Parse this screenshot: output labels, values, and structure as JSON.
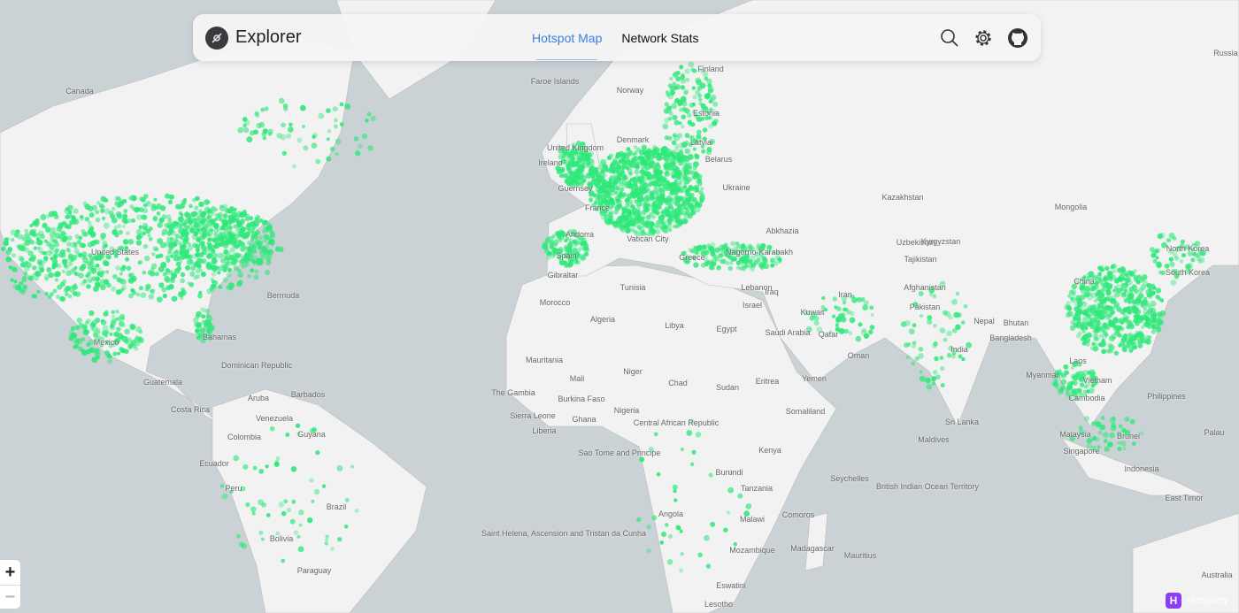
{
  "header": {
    "brand": "Explorer",
    "tabs": [
      {
        "label": "Hotspot Map",
        "active": true
      },
      {
        "label": "Network Stats",
        "active": false
      }
    ]
  },
  "colors": {
    "accent": "#3b7ee0",
    "hotspot": "#2fe87a",
    "ocean": "#cbd2d5",
    "land": "#f2f2f2",
    "brand_badge": "#8a3ff0"
  },
  "map": {
    "labels": [
      "Canada",
      "United States",
      "Mexico",
      "Bermuda",
      "Bahamas",
      "Dominican Republic",
      "Guatemala",
      "Costa Rica",
      "Aruba",
      "Barbados",
      "Venezuela",
      "Colombia",
      "Guyana",
      "Ecuador",
      "Peru",
      "Brazil",
      "Bolivia",
      "Paraguay",
      "Faroe Islands",
      "Norway",
      "Finland",
      "Estonia",
      "Latvia",
      "Belarus",
      "Ukraine",
      "United Kingdom",
      "Ireland",
      "Denmark",
      "Guernsey",
      "France",
      "Andorra",
      "Spain",
      "Gibraltar",
      "Vatican City",
      "Greece",
      "Morocco",
      "Tunisia",
      "Algeria",
      "Libya",
      "Egypt",
      "Mauritania",
      "Mali",
      "Niger",
      "Chad",
      "Sudan",
      "Eritrea",
      "Yemen",
      "Somaliland",
      "The Gambia",
      "Sierra Leone",
      "Liberia",
      "Burkina Faso",
      "Ghana",
      "Nigeria",
      "Central African Republic",
      "Sao Tome and Principe",
      "Kenya",
      "Burundi",
      "Tanzania",
      "Angola",
      "Malawi",
      "Comoros",
      "Mozambique",
      "Madagascar",
      "Mauritius",
      "Seychelles",
      "Saint Helena, Ascension and Tristan da Cunha",
      "Eswatini",
      "Lesotho",
      "Abkhazia",
      "Nagorno-Karabakh",
      "Lebanon",
      "Israel",
      "Iraq",
      "Iran",
      "Kuwait",
      "Saudi Arabia",
      "Qatar",
      "Oman",
      "Kazakhstan",
      "Uzbekistan",
      "Kyrgyzstan",
      "Tajikistan",
      "Afghanistan",
      "Pakistan",
      "Nepal",
      "Bhutan",
      "Bangladesh",
      "India",
      "Sri Lanka",
      "Maldives",
      "British Indian Ocean Territory",
      "Mongolia",
      "China",
      "North Korea",
      "South Korea",
      "Myanmar",
      "Laos",
      "Vietnam",
      "Cambodia",
      "Philippines",
      "Malaysia",
      "Brunei",
      "Singapore",
      "Indonesia",
      "East Timor",
      "Palau",
      "Russia",
      "Australia"
    ]
  },
  "controls": {
    "zoom_in": "+",
    "zoom_out": "−"
  },
  "attribution": {
    "badge": "H",
    "text": "Hotspotty"
  }
}
